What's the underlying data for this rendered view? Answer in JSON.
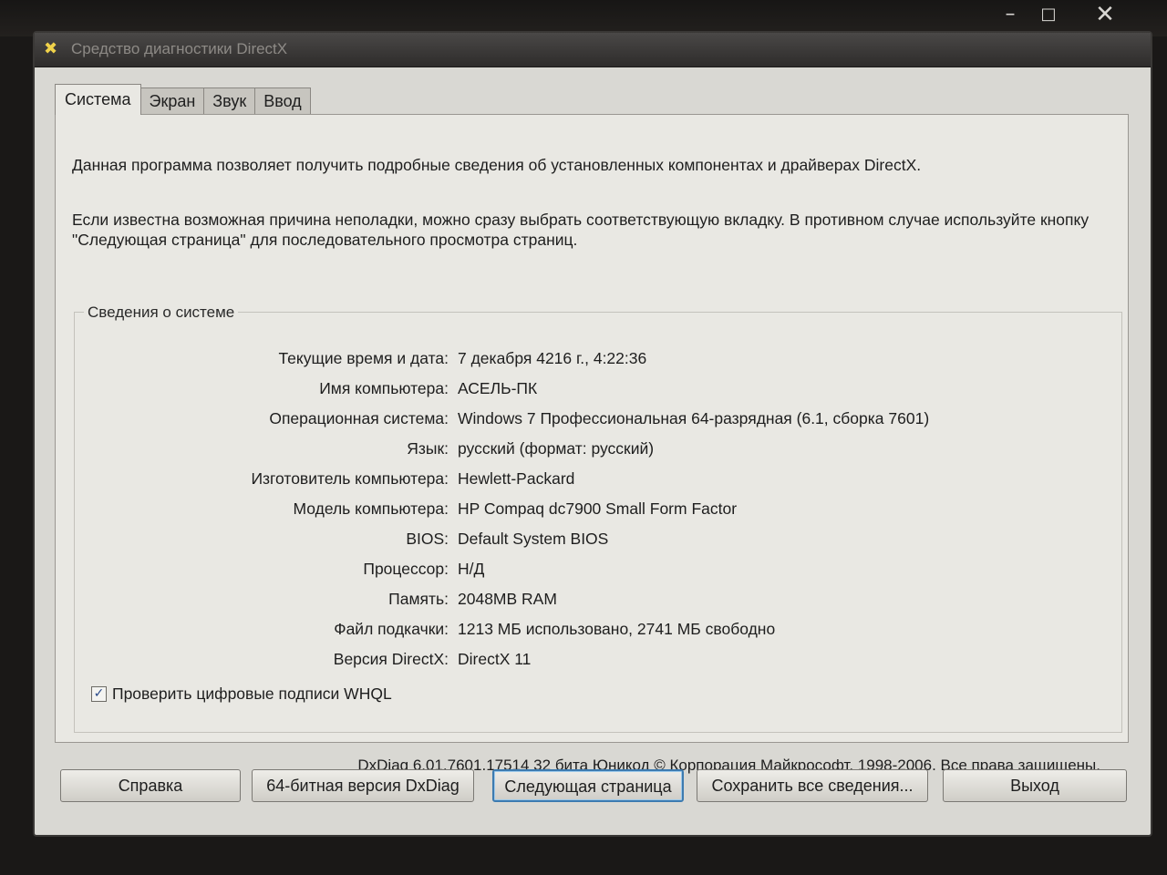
{
  "window": {
    "title": "Средство диагностики DirectX",
    "controls": {
      "minimize": "–",
      "maximize": "□",
      "close": "✕"
    }
  },
  "tabs": [
    "Система",
    "Экран",
    "Звук",
    "Ввод"
  ],
  "intro": {
    "line1": "Данная программа позволяет получить подробные сведения об установленных компонентах и драйверах DirectX.",
    "line2": "Если известна возможная причина неполадки, можно сразу выбрать соответствующую вкладку. В противном случае используйте кнопку \"Следующая страница\" для последовательного просмотра страниц."
  },
  "system_info": {
    "group_title": "Сведения о системе",
    "rows": [
      {
        "label": "Текущие время и дата:",
        "value": "7 декабря 4216 г., 4:22:36"
      },
      {
        "label": "Имя компьютера:",
        "value": "АСЕЛЬ-ПК"
      },
      {
        "label": "Операционная система:",
        "value": "Windows 7 Профессиональная 64-разрядная (6.1, сборка 7601)"
      },
      {
        "label": "Язык:",
        "value": "русский (формат: русский)"
      },
      {
        "label": "Изготовитель компьютера:",
        "value": "Hewlett-Packard"
      },
      {
        "label": "Модель компьютера:",
        "value": "HP Compaq dc7900 Small Form Factor"
      },
      {
        "label": "BIOS:",
        "value": "Default System BIOS"
      },
      {
        "label": "Процессор:",
        "value": "Н/Д"
      },
      {
        "label": "Память:",
        "value": "2048MB RAM"
      },
      {
        "label": "Файл подкачки:",
        "value": "1213 МБ использовано, 2741 МБ свободно"
      },
      {
        "label": "Версия DirectX:",
        "value": "DirectX 11"
      }
    ]
  },
  "whql": {
    "label": "Проверить цифровые подписи WHQL",
    "checked": true,
    "check_glyph": "✓"
  },
  "copyright": "DxDiag 6.01.7601.17514 32 бита Юникод  © Корпорация Майкрософт, 1998-2006.  Все права защищены.",
  "buttons": {
    "help": "Справка",
    "dxdiag64": "64-битная версия DxDiag",
    "next": "Следующая страница",
    "save": "Сохранить все сведения...",
    "exit": "Выход"
  },
  "icons": {
    "app": "directx-icon"
  }
}
